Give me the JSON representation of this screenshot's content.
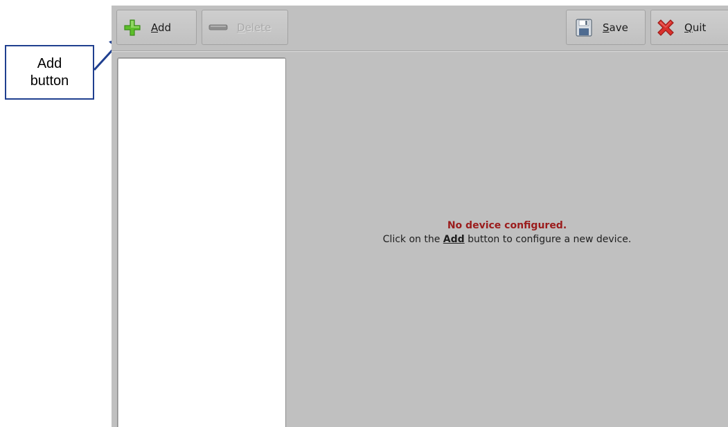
{
  "annotation": {
    "line1": "Add",
    "line2": "button",
    "color": "#1f3f8f"
  },
  "toolbar": {
    "add": {
      "mnemonic": "A",
      "rest": "dd",
      "icon": "plus-icon",
      "enabled": true
    },
    "delete": {
      "mnemonic": "D",
      "rest": "elete",
      "icon": "minus-icon",
      "enabled": false
    },
    "save": {
      "mnemonic": "S",
      "rest": "ave",
      "icon": "floppy-disk-icon",
      "enabled": true
    },
    "quit": {
      "mnemonic": "Q",
      "rest": "uit",
      "icon": "red-x-icon",
      "enabled": true
    }
  },
  "device_list": {
    "items": []
  },
  "main": {
    "title": "No device configured.",
    "body_prefix": "Click on the ",
    "body_keyword": "Add",
    "body_suffix": " button to configure a new device.",
    "title_color": "#9b1c1c"
  },
  "colors": {
    "window_bg": "#c0c0c0",
    "list_bg": "#ffffff",
    "add_icon_green": "#5cbf2a",
    "quit_icon_red": "#d9302c"
  }
}
